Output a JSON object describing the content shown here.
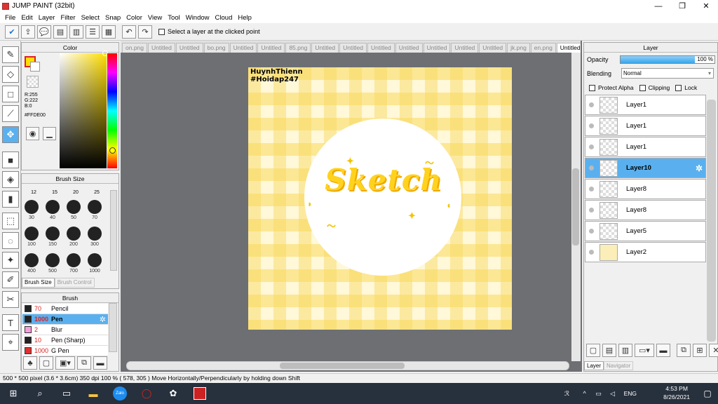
{
  "window": {
    "title": "JUMP PAINT (32bit)",
    "minimize": "—",
    "maximize": "❐",
    "close": "✕"
  },
  "menu": [
    "File",
    "Edit",
    "Layer",
    "Filter",
    "Select",
    "Snap",
    "Color",
    "View",
    "Tool",
    "Window",
    "Cloud",
    "Help"
  ],
  "toolbar": {
    "select_layer_label": "Select a layer at the clicked point",
    "select_layer_checked": false
  },
  "color_panel": {
    "title": "Color",
    "r": "R:255",
    "g": "G:222",
    "b": "B:0",
    "hex": "#FFDE00",
    "main_color": "#ffde00"
  },
  "brush_size_panel": {
    "title": "Brush Size",
    "row_top_labels": [
      "12",
      "15",
      "20",
      "25"
    ],
    "rows": [
      [
        "30",
        "40",
        "50",
        "70"
      ],
      [
        "100",
        "150",
        "200",
        "300"
      ],
      [
        "400",
        "500",
        "700",
        "1000"
      ]
    ],
    "tabs": [
      "Brush Size",
      "Brush Control"
    ]
  },
  "brush_panel": {
    "title": "Brush",
    "items": [
      {
        "size": "70",
        "name": "Pencil",
        "color": "#222222"
      },
      {
        "size": "1000",
        "name": "Pen",
        "color": "#222222"
      },
      {
        "size": "2",
        "name": "Blur",
        "color": "#f5a0dc"
      },
      {
        "size": "10",
        "name": "Pen (Sharp)",
        "color": "#222222"
      },
      {
        "size": "1000",
        "name": "G Pen",
        "color": "#e03030"
      }
    ],
    "selected_index": 1
  },
  "tabs": [
    "on.png",
    "Untitled",
    "Untitled",
    "bo.png",
    "Untitled",
    "Untitled",
    "85.png",
    "Untitled",
    "Untitled",
    "Untitled",
    "Untitled",
    "Untitled",
    "Untitled",
    "Untitled",
    "jk.png",
    "en.png",
    "Untitled"
  ],
  "active_tab": 16,
  "canvas": {
    "watermark_line1": "HuynhThienn",
    "watermark_line2": "#Hoidap247",
    "art_text": "Sketch"
  },
  "layer_panel": {
    "title": "Layer",
    "opacity_label": "Opacity",
    "opacity_value": "100 %",
    "blending_label": "Blending",
    "blending_value": "Normal",
    "protect_alpha": "Protect Alpha",
    "clipping": "Clipping",
    "lock": "Lock",
    "layers": [
      "Layer1",
      "Layer1",
      "Layer1",
      "Layer10",
      "Layer8",
      "Layer8",
      "Layer5",
      "Layer2"
    ],
    "selected_index": 3,
    "bottom_tabs": [
      "Layer",
      "Navigator"
    ]
  },
  "status": {
    "size": "500 * 500 pixel",
    "physical": "(3.6 * 3.6cm)",
    "dpi": "350 dpi",
    "zoom": "100 %",
    "coords": "( 578, 305 )",
    "hint": "Move Horizontally/Perpendicularly by holding down Shift"
  },
  "taskbar": {
    "time": "4:53 PM",
    "date": "8/26/2021",
    "lang": "ENG",
    "zalo_label": "Zalo"
  }
}
